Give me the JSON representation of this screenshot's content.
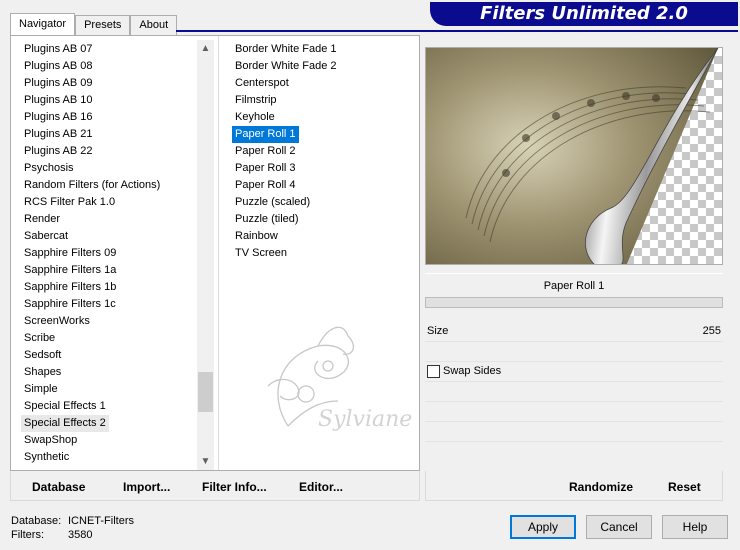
{
  "tabs": [
    "Navigator",
    "Presets",
    "About"
  ],
  "banner": "Filters Unlimited 2.0",
  "categories": [
    "Plugins AB 07",
    "Plugins AB 08",
    "Plugins AB 09",
    "Plugins AB 10",
    "Plugins AB 16",
    "Plugins AB 21",
    "Plugins AB 22",
    "Psychosis",
    "Random Filters (for Actions)",
    "RCS Filter Pak 1.0",
    "Render",
    "Sabercat",
    "Sapphire Filters 09",
    "Sapphire Filters 1a",
    "Sapphire Filters 1b",
    "Sapphire Filters 1c",
    "ScreenWorks",
    "Scribe",
    "Sedsoft",
    "Shapes",
    "Simple",
    "Special Effects 1",
    "Special Effects 2",
    "SwapShop",
    "Synthetic"
  ],
  "selected_category": "Special Effects 2",
  "filters": [
    "Border White Fade 1",
    "Border White Fade 2",
    "Centerspot",
    "Filmstrip",
    "Keyhole",
    "Paper Roll 1",
    "Paper Roll 2",
    "Paper Roll 3",
    "Paper Roll 4",
    "Puzzle (scaled)",
    "Puzzle (tiled)",
    "Rainbow",
    "TV Screen"
  ],
  "selected_filter": "Paper Roll 1",
  "watermark_text": "Sylviane",
  "preview": {
    "filter_name": "Paper Roll 1"
  },
  "params": {
    "size_label": "Size",
    "size_value": "255",
    "swap_sides_label": "Swap Sides"
  },
  "left_buttons": {
    "database": "Database",
    "import": "Import...",
    "filter_info": "Filter Info...",
    "editor": "Editor..."
  },
  "right_buttons": {
    "randomize": "Randomize",
    "reset": "Reset"
  },
  "status": {
    "database_label": "Database:",
    "database_value": "ICNET-Filters",
    "filters_label": "Filters:",
    "filters_value": "3580"
  },
  "dialog_buttons": {
    "apply": "Apply",
    "cancel": "Cancel",
    "help": "Help"
  },
  "colors": {
    "banner": "#0b0b8f",
    "selection": "#0078d7"
  }
}
